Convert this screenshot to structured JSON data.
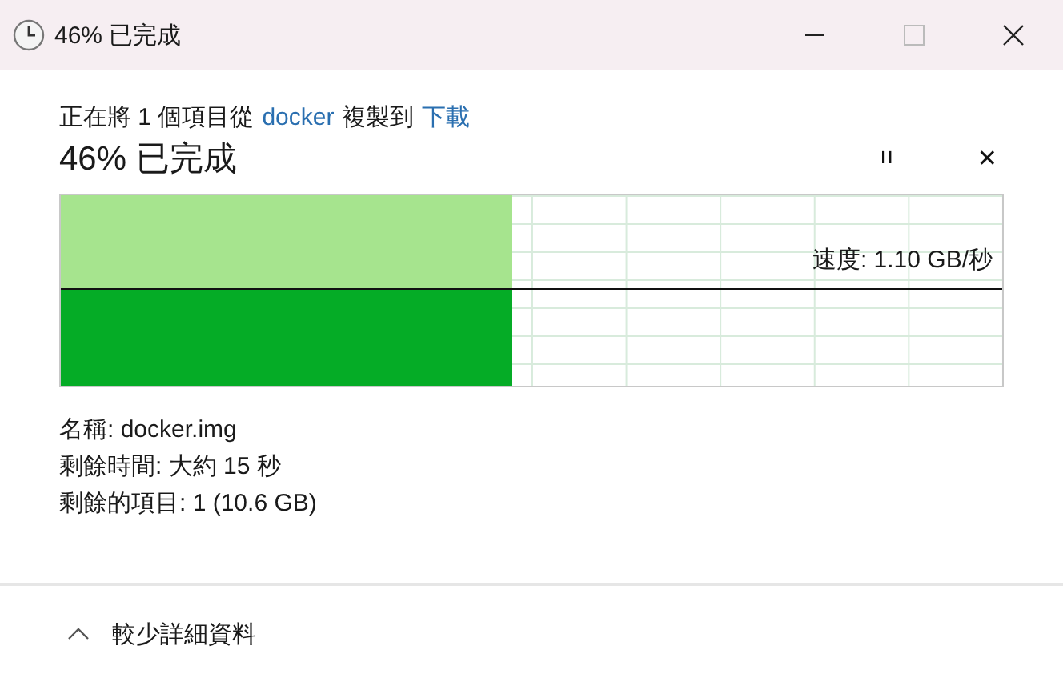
{
  "window": {
    "title": "46% 已完成"
  },
  "copy_line": {
    "prefix": "正在將 1 個項目從",
    "source": "docker",
    "middle": "複製到",
    "destination": "下載"
  },
  "heading": "46% 已完成",
  "controls": {
    "pause": "II",
    "cancel": "✕"
  },
  "progress": {
    "level": 0.48,
    "speed": "速度: 1.10 GB/秒"
  },
  "details": [
    "名稱: docker.img",
    "剩餘時間: 大約 15 秒",
    "剩餘的項目: 1 (10.6 GB)"
  ],
  "footer": {
    "toggle": "較少詳細資料",
    "expanded": true
  }
}
